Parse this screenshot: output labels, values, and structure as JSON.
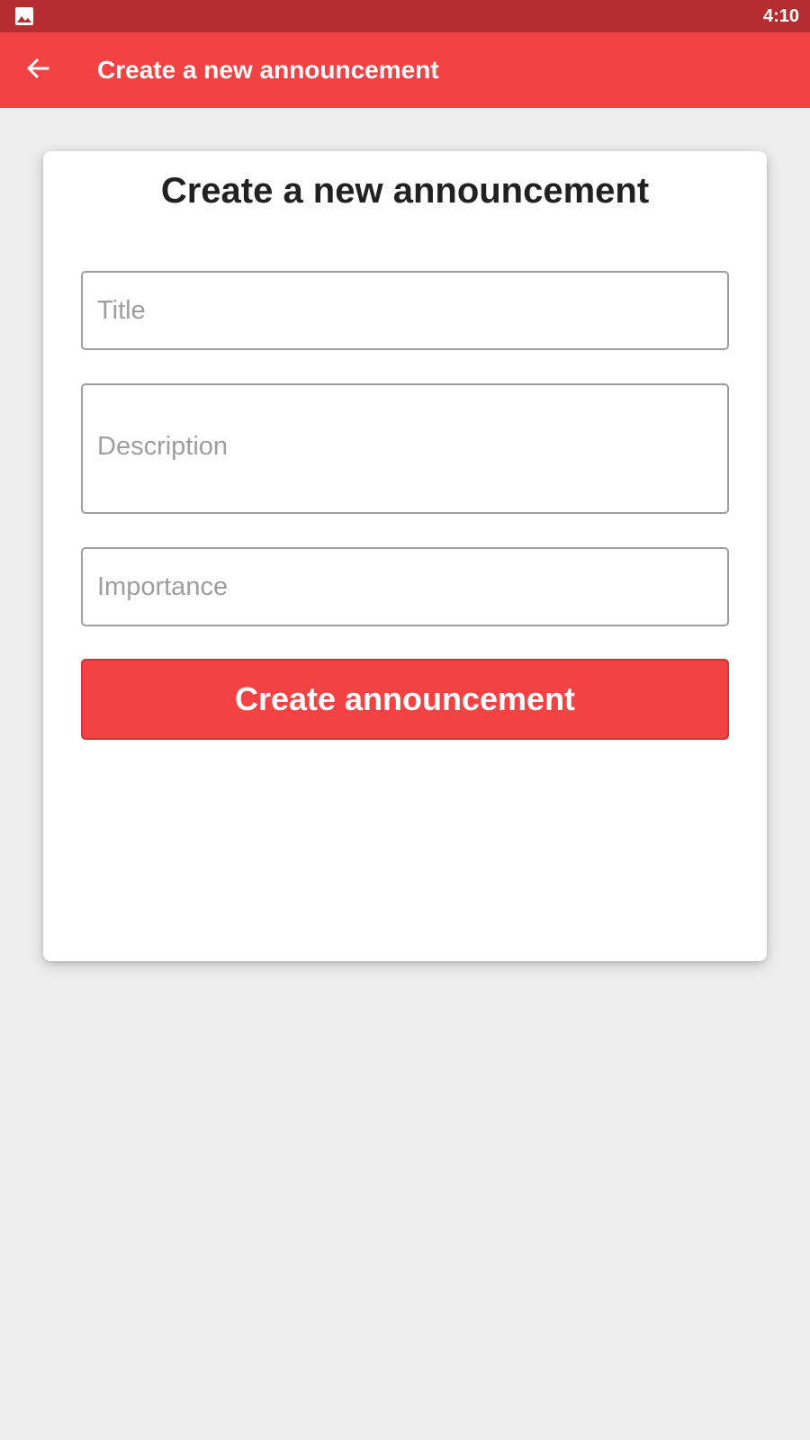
{
  "status_bar": {
    "notification_icon": "image-icon",
    "time": "4:10"
  },
  "app_bar": {
    "back_icon": "arrow-back-icon",
    "title": "Create a new announcement"
  },
  "form": {
    "heading": "Create a new announcement",
    "title_field": {
      "value": "",
      "placeholder": "Title"
    },
    "description_field": {
      "value": "",
      "placeholder": "Description"
    },
    "importance_field": {
      "value": "",
      "placeholder": "Importance"
    },
    "submit_label": "Create announcement"
  },
  "colors": {
    "status_bar": "#b52d30",
    "app_bar": "#f24243",
    "accent": "#f24243",
    "background": "#ededed"
  }
}
